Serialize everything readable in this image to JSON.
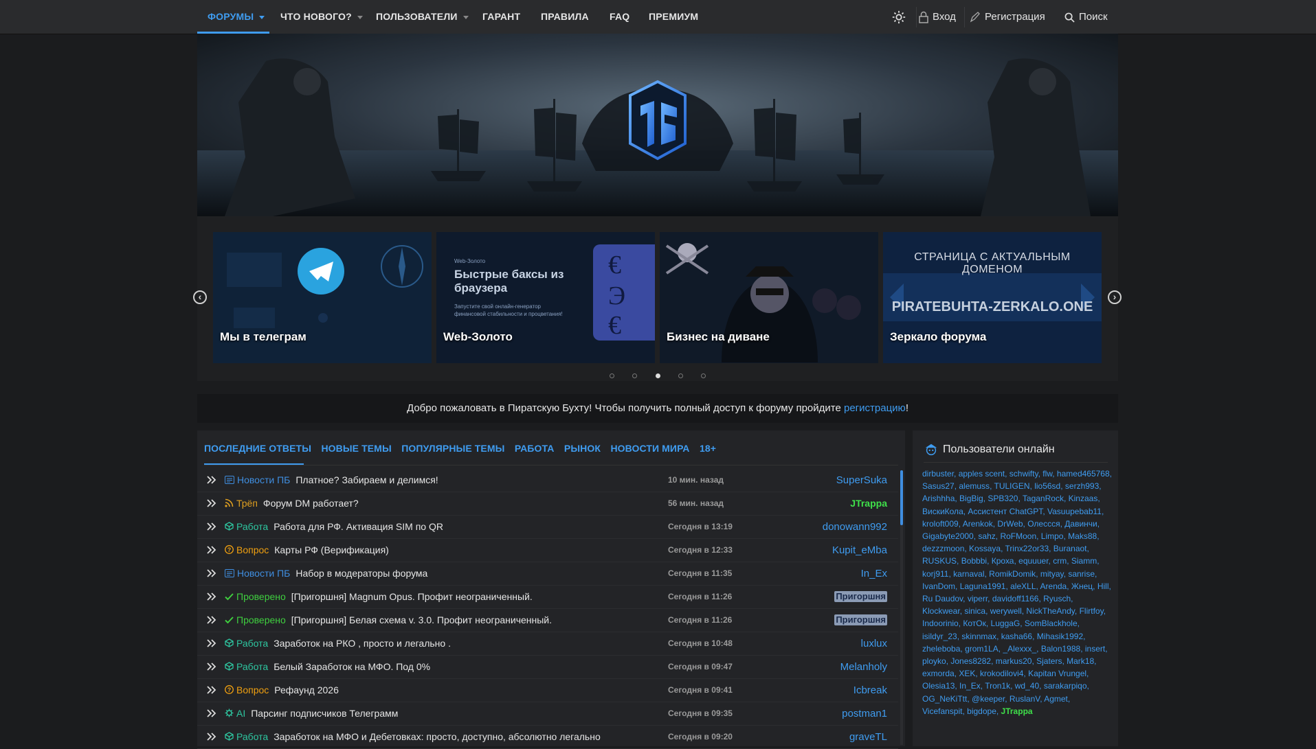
{
  "nav": {
    "items": [
      {
        "label": "ФОРУМЫ",
        "active": true,
        "dropdown": true
      },
      {
        "label": "ЧТО НОВОГО?",
        "dropdown": true
      },
      {
        "label": "ПОЛЬЗОВАТЕЛИ",
        "dropdown": true
      },
      {
        "label": "ГАРАНТ"
      },
      {
        "label": "ПРАВИЛА"
      },
      {
        "label": "FAQ"
      },
      {
        "label": "ПРЕМИУМ"
      }
    ],
    "settings_icon": "gear-icon",
    "login": "Вход",
    "register": "Регистрация",
    "search": "Поиск"
  },
  "banner": {
    "logo_text": "ПБ"
  },
  "slider": {
    "slides": [
      {
        "title": "Мы в телеграм"
      },
      {
        "title": "Web-Золото",
        "small": "Web-Золото",
        "headline": "Быстрые баксы из браузера",
        "desc": "Запустите свой онлайн-генератор финансовой стабильности и процветания!"
      },
      {
        "title": "Бизнес на диване"
      },
      {
        "title": "Зеркало форума",
        "top_text": "СТРАНИЦА С АКТУАЛЬНЫМ ДОМЕНОМ",
        "domain": "PIRATEBUHTA-ZERKALO.ONE"
      }
    ],
    "prev": "‹",
    "next": "›",
    "dots": 5,
    "active_dot": 3
  },
  "welcome": {
    "text": "Добро пожаловать в Пиратскую Бухту! Чтобы получить полный доступ к форуму пройдите ",
    "link": "регистрацию",
    "end": "!"
  },
  "tabs": [
    "ПОСЛЕДНИЕ ОТВЕТЫ",
    "НОВЫЕ ТЕМЫ",
    "ПОПУЛЯРНЫЕ ТЕМЫ",
    "РАБОТА",
    "РЫНОК",
    "НОВОСТИ МИРА",
    "18+"
  ],
  "threads": [
    {
      "prefix": "Новости ПБ",
      "prefix_color": "#3f8ee0",
      "icon": "news-icon",
      "title": "Платное? Забираем и делимся!",
      "time": "10 мин. назад",
      "user": "SuperSuka",
      "user_style": "normal"
    },
    {
      "prefix": "Трёп",
      "prefix_color": "#e0a020",
      "icon": "rss-icon",
      "title": "Форум DM работает?",
      "time": "56 мин. назад",
      "user": "JTrappa",
      "user_style": "green"
    },
    {
      "prefix": "Работа",
      "prefix_color": "#2ec6a0",
      "icon": "cube-icon",
      "title": "Работа для РФ. Активация SIM по QR",
      "time": "Сегодня в 13:19",
      "user": "donowann992",
      "user_style": "normal"
    },
    {
      "prefix": "Вопрос",
      "prefix_color": "#f0a010",
      "icon": "question-icon",
      "title": "Карты РФ (Верификация)",
      "time": "Сегодня в 12:33",
      "user": "Kupit_eMba",
      "user_style": "normal"
    },
    {
      "prefix": "Новости ПБ",
      "prefix_color": "#3f8ee0",
      "icon": "news-icon",
      "title": "Набор в модераторы форума",
      "time": "Сегодня в 11:35",
      "user": "In_Ex",
      "user_style": "normal"
    },
    {
      "prefix": "Проверено",
      "prefix_color": "#3fcf3f",
      "icon": "check-icon",
      "title": "[Пригоршня] Magnum Opus. Профит неограниченный.",
      "time": "Сегодня в 11:26",
      "user": "Пригоршня",
      "user_style": "badge"
    },
    {
      "prefix": "Проверено",
      "prefix_color": "#3fcf3f",
      "icon": "check-icon",
      "title": "[Пригоршня] Белая схема v. 3.0. Профит неограниченный.",
      "time": "Сегодня в 11:26",
      "user": "Пригоршня",
      "user_style": "badge"
    },
    {
      "prefix": "Работа",
      "prefix_color": "#2ec6a0",
      "icon": "cube-icon",
      "title": "Заработок на РКО , просто и легально .",
      "time": "Сегодня в 10:48",
      "user": "luxlux",
      "user_style": "normal"
    },
    {
      "prefix": "Работа",
      "prefix_color": "#2ec6a0",
      "icon": "cube-icon",
      "title": "Белый Заработок на МФО. Под 0%",
      "time": "Сегодня в 09:47",
      "user": "Melanholy",
      "user_style": "normal"
    },
    {
      "prefix": "Вопрос",
      "prefix_color": "#f0a010",
      "icon": "question-icon",
      "title": "Рефаунд 2026",
      "time": "Сегодня в 09:41",
      "user": "Icbreak",
      "user_style": "normal"
    },
    {
      "prefix": "AI",
      "prefix_color": "#2ec6a0",
      "icon": "ai-icon",
      "title": "Парсинг подписчиков Телеграмм",
      "time": "Сегодня в 09:35",
      "user": "postman1",
      "user_style": "normal"
    },
    {
      "prefix": "Работа",
      "prefix_color": "#2ec6a0",
      "icon": "cube-icon",
      "title": "Заработок на МФО и Дебетовках: просто, доступно, абсолютно легально",
      "time": "Сегодня в 09:20",
      "user": "graveTL",
      "user_style": "normal"
    }
  ],
  "sidebar": {
    "title": "Пользователи онлайн",
    "users": [
      "dirbuster",
      "apples scent",
      "schwifty",
      "flw",
      "hamed465768",
      "Sasus27",
      "alemuss",
      "TULIGEN",
      "lio56sd",
      "serzh993",
      "Arishhha",
      "BigBig",
      "SPB320",
      "TaganRock",
      "Kinzaas",
      "ВискиКола",
      "Ассистент ChatGPT",
      "Vasuupebab11",
      "kroloft009",
      "Arenkok",
      "DrWeb",
      "Олессся",
      "Давинчи",
      "Gigabyte2000",
      "sahz",
      "RoFMoon",
      "Limpo",
      "Maks88",
      "dezzzmoon",
      "Kossaya",
      "Trinx22or33",
      "Buranaot",
      "RUSKUS",
      "Bobbbi",
      "Кроха",
      "equuuer",
      "crm",
      "Siamm",
      "korj911",
      "karnaval",
      "RomikDomik",
      "mityay",
      "sanrise",
      "IvanDom",
      "Laguna1991",
      "aleXLL",
      "Arenda",
      "Жнец",
      "Hill",
      "Ru Daudov",
      "viperr",
      "davidoff1166",
      "Ryusch",
      "Klockwear",
      "sinica",
      "werywell",
      "NickTheAndy",
      "Flirtfoy",
      "Indoorinio",
      "КотОк",
      "LuggaG",
      "SomBlackhole",
      "isildyr_23",
      "skinnmax",
      "kasha66",
      "Mihasik1992",
      "zheleboba",
      "grom1LA",
      "_Alexxx_",
      "Balon1988",
      "insert",
      "ployko",
      "Jones8282",
      "markus20",
      "Sjaters",
      "Mark18",
      "exmorda",
      "XEK",
      "krokodilovi4",
      "Kapitan Vrungel",
      "Olesia13",
      "In_Ex",
      "Tron1k",
      "wd_40",
      "sarakarpiqo",
      "OG_NeKiTtt",
      "@keeper",
      "RuslanV",
      "Agmet",
      "Vicefanspit",
      "bigdope",
      "JTrappa"
    ],
    "green_users": [
      "JTrappa"
    ]
  },
  "colors": {
    "accent": "#3f9cf0",
    "bg": "#1b1c1e",
    "panel": "#232427"
  }
}
